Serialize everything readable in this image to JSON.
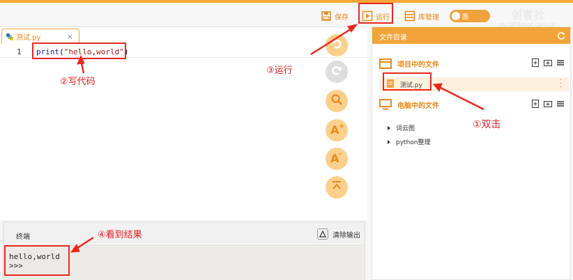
{
  "toolbar": {
    "save_label": "保存",
    "run_label": "运行",
    "library_label": "库管理",
    "toggle_label": "图",
    "logo_name": "创客社",
    "logo_url": "mc.DFRobot.com.cn"
  },
  "editor": {
    "tab_label": "测试.py",
    "tab_close": "×",
    "line_number": "1",
    "code_keyword": "print",
    "code_open": "(",
    "code_string": "\"hello,world\"",
    "code_close": ")"
  },
  "terminal": {
    "title": "终端",
    "clear_label": "清除输出",
    "output_line1": "hello,world",
    "output_line2": ">>>"
  },
  "file_panel": {
    "title": "文件目录",
    "project_section": "项目中的文件",
    "project_file": "测试.py",
    "computer_section": "电脑中的文件",
    "folders": [
      "词云图",
      "python整理"
    ]
  },
  "annotations": {
    "step1": "①双击",
    "step2": "②写代码",
    "step3": "③运行",
    "step4": "④看到结果"
  },
  "colors": {
    "accent": "#f2a43a",
    "annotation": "#e8281e"
  },
  "icons": [
    "save-icon",
    "run-icon",
    "library-icon",
    "python-file-icon",
    "undo-icon",
    "redo-icon",
    "search-icon",
    "font-increase-icon",
    "font-decrease-icon",
    "collapse-icon",
    "clear-icon",
    "refresh-icon",
    "folder-icon",
    "monitor-icon",
    "new-file-icon",
    "new-folder-icon",
    "menu-icon",
    "more-icon"
  ]
}
